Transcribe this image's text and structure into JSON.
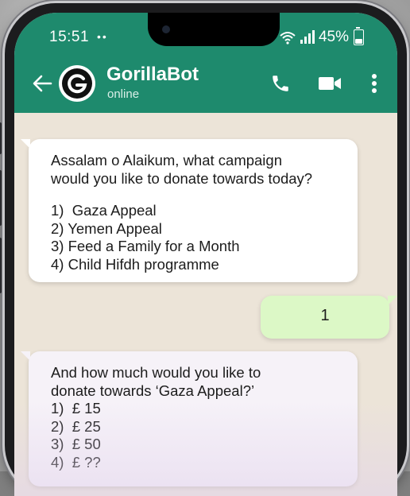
{
  "status_bar": {
    "time": "15:51",
    "time_dots": "••",
    "battery_percent": "45%",
    "battery_level": 0.45
  },
  "app_bar": {
    "contact_name": "GorillaBot",
    "contact_status": "online",
    "header_color": "#1e8a6d",
    "icons": [
      "back-arrow-icon",
      "gorilla-logo-icon",
      "phone-icon",
      "video-camera-icon",
      "more-vertical-icon"
    ]
  },
  "messages": [
    {
      "direction": "incoming",
      "lines": [
        "Assalam o Alaikum, what campaign",
        "would you like to donate towards today?",
        "",
        "1)  Gaza Appeal",
        "2) Yemen Appeal",
        "3) Feed a Family for a Month",
        "4) Child Hifdh programme"
      ]
    },
    {
      "direction": "outgoing",
      "text": "1"
    },
    {
      "direction": "incoming",
      "lines": [
        "And how much would you like to",
        "donate towards ‘Gaza Appeal?’",
        "1)  £ 15",
        "2)  £ 25",
        "3)  £ 50",
        "4)  £ ??"
      ]
    }
  ]
}
